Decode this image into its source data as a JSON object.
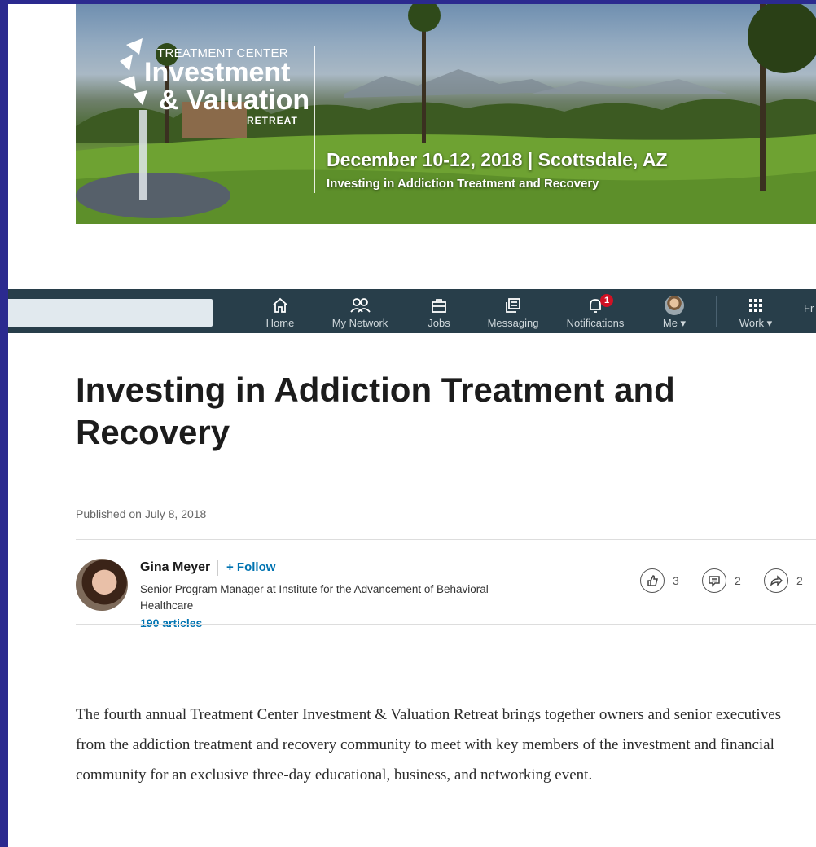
{
  "banner": {
    "logo_line1": "TREATMENT CENTER",
    "logo_line2": "Investment",
    "logo_line3": "& Valuation",
    "logo_line4": "RETREAT",
    "date_location": "December 10-12, 2018 | Scottsdale, AZ",
    "subtitle": "Investing in Addiction Treatment and Recovery"
  },
  "navbar": {
    "items": [
      {
        "label": "Home",
        "icon": "home-icon"
      },
      {
        "label": "My Network",
        "icon": "network-icon"
      },
      {
        "label": "Jobs",
        "icon": "briefcase-icon"
      },
      {
        "label": "Messaging",
        "icon": "messaging-icon"
      },
      {
        "label": "Notifications",
        "icon": "bell-icon",
        "badge": "1"
      },
      {
        "label": "Me ▾",
        "icon": "avatar"
      },
      {
        "label": "Work ▾",
        "icon": "grid-icon"
      }
    ],
    "more_text": "Fr",
    "colors": {
      "bar": "#283e4a",
      "badge": "#d11124"
    }
  },
  "article": {
    "title": "Investing in Addiction Treatment and Recovery",
    "published": "Published on July 8, 2018",
    "author": {
      "name": "Gina Meyer",
      "follow_label": "+ Follow",
      "headline": "Senior Program Manager at Institute for the Advancement of Behavioral Healthcare",
      "articles": "190 articles"
    },
    "social": {
      "likes": "3",
      "comments": "2",
      "shares": "2"
    },
    "body": "The fourth annual Treatment Center Investment & Valuation Retreat brings together owners and senior executives from the addiction treatment and recovery community to meet with key members of the investment and financial community for an exclusive three-day educational, business, and networking event."
  },
  "colors": {
    "frame": "#2b2a8f",
    "link": "#0073b1"
  }
}
